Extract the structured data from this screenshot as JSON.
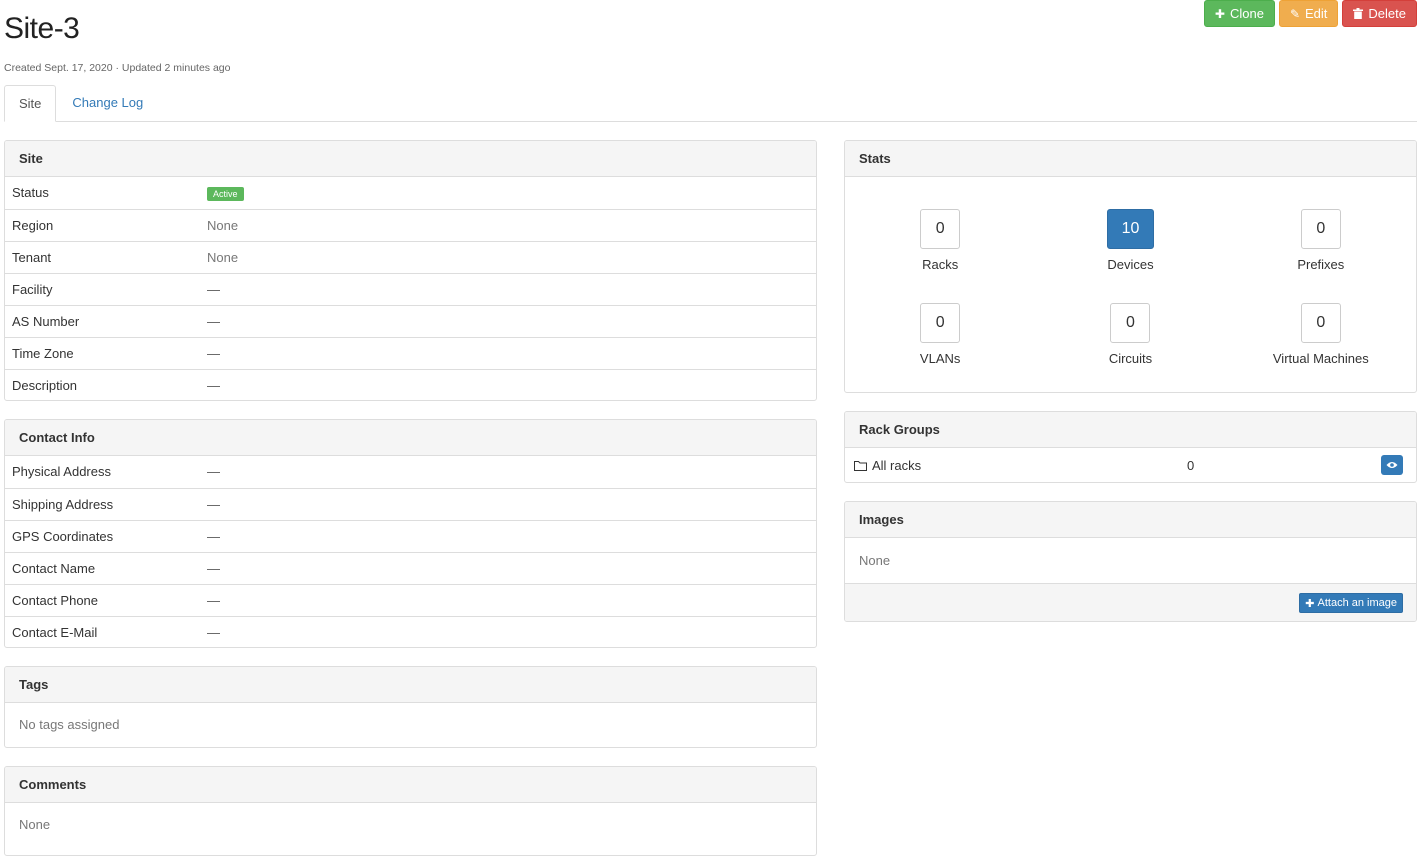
{
  "page": {
    "title": "Site-3",
    "meta": "Created Sept. 17, 2020 · Updated 2 minutes ago"
  },
  "actions": {
    "clone": "Clone",
    "edit": "Edit",
    "delete": "Delete"
  },
  "tabs": [
    {
      "label": "Site",
      "active": true
    },
    {
      "label": "Change Log",
      "active": false
    }
  ],
  "site_panel": {
    "title": "Site",
    "rows": [
      {
        "label": "Status",
        "value": "Active"
      },
      {
        "label": "Region",
        "value": "None"
      },
      {
        "label": "Tenant",
        "value": "None"
      },
      {
        "label": "Facility",
        "value": "—"
      },
      {
        "label": "AS Number",
        "value": "—"
      },
      {
        "label": "Time Zone",
        "value": "—"
      },
      {
        "label": "Description",
        "value": "—"
      }
    ]
  },
  "contact_panel": {
    "title": "Contact Info",
    "rows": [
      {
        "label": "Physical Address",
        "value": "—"
      },
      {
        "label": "Shipping Address",
        "value": "—"
      },
      {
        "label": "GPS Coordinates",
        "value": "—"
      },
      {
        "label": "Contact Name",
        "value": "—"
      },
      {
        "label": "Contact Phone",
        "value": "—"
      },
      {
        "label": "Contact E-Mail",
        "value": "—"
      }
    ]
  },
  "tags_panel": {
    "title": "Tags",
    "body": "No tags assigned"
  },
  "comments_panel": {
    "title": "Comments",
    "body": "None"
  },
  "stats_panel": {
    "title": "Stats",
    "items": [
      {
        "count": "0",
        "label": "Racks"
      },
      {
        "count": "10",
        "label": "Devices",
        "highlight": true
      },
      {
        "count": "0",
        "label": "Prefixes"
      },
      {
        "count": "0",
        "label": "VLANs"
      },
      {
        "count": "0",
        "label": "Circuits"
      },
      {
        "count": "0",
        "label": "Virtual Machines"
      }
    ]
  },
  "rack_groups_panel": {
    "title": "Rack Groups",
    "row": {
      "name": "All racks",
      "count": "0"
    }
  },
  "images_panel": {
    "title": "Images",
    "body": "None",
    "attach_label": "Attach an image"
  },
  "colors": {
    "success": "#5cb85c",
    "warning": "#f0ad4e",
    "danger": "#d9534f",
    "primary": "#337ab7"
  }
}
